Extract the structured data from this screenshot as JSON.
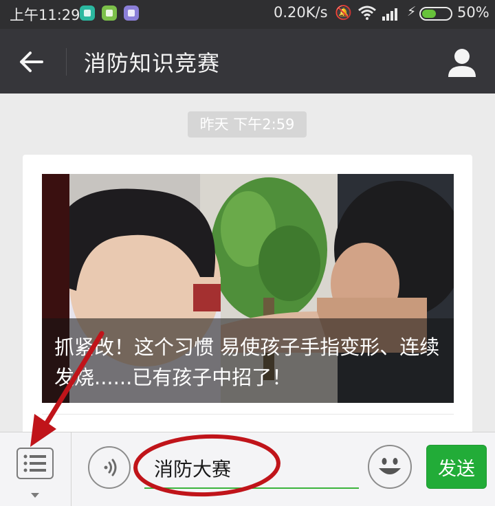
{
  "status_bar": {
    "time": "上午11:29",
    "net_speed": "0.20K/s",
    "battery_pct": "50%",
    "battery_level": 0.5,
    "icons": [
      "app-icon-green",
      "app-icon-lime",
      "app-icon-purple",
      "mute-icon",
      "wifi-icon",
      "signal-icon",
      "charging-icon",
      "battery-icon"
    ]
  },
  "header": {
    "title": "消防知识竞赛",
    "back_icon": "arrow-left-icon",
    "profile_icon": "person-icon"
  },
  "chat": {
    "timestamp": "昨天 下午2:59",
    "article": {
      "title": "抓紧改！这个习惯  易使孩子手指变形、连续发烧......已有孩子中招了！"
    }
  },
  "input_bar": {
    "menu_icon": "list-menu-icon",
    "voice_icon": "voice-icon",
    "text_value": "消防大赛",
    "emoji_icon": "smiley-icon",
    "send_label": "发送"
  },
  "colors": {
    "header_bg": "#36363a",
    "send_green": "#22ac38",
    "annotation_red": "#c0141a"
  }
}
